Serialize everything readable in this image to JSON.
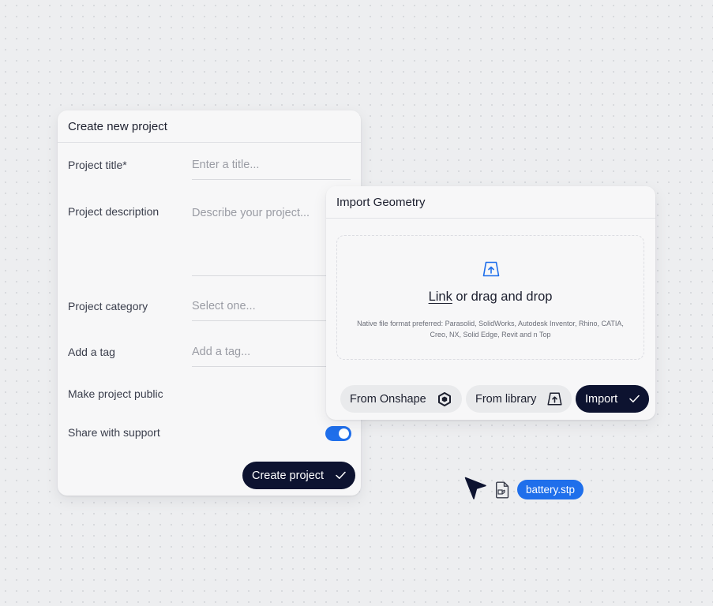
{
  "create_project": {
    "title": "Create new project",
    "fields": [
      {
        "label": "Project title*",
        "placeholder": "Enter a title..."
      },
      {
        "label": "Project description",
        "placeholder": "Describe your project..."
      },
      {
        "label": "Project category",
        "placeholder": "Select one..."
      },
      {
        "label": "Add a tag",
        "placeholder": "Add a tag..."
      }
    ],
    "make_public_label": "Make project public",
    "share_support_label": "Share with support",
    "share_support_on": true,
    "submit_label": "Create project"
  },
  "import_geometry": {
    "title": "Import Geometry",
    "drop_link": "Link",
    "drop_text": " or drag and drop",
    "note": "Native file format preferred: Parasolid, SolidWorks, Autodesk Inventor, Rhino, CATIA, Creo, NX, Solid Edge, Revit and n Top",
    "onshape_label": "From Onshape",
    "library_label": "From library",
    "import_label": "Import"
  },
  "dragged_file": {
    "name": "battery.stp"
  },
  "colors": {
    "accent": "#1f6feb",
    "dark_button": "#0d1330",
    "background": "#edeef0"
  },
  "icons": [
    "upload-tray-icon",
    "onshape-icon",
    "check-icon",
    "cursor-arrow-icon",
    "file-icon"
  ]
}
